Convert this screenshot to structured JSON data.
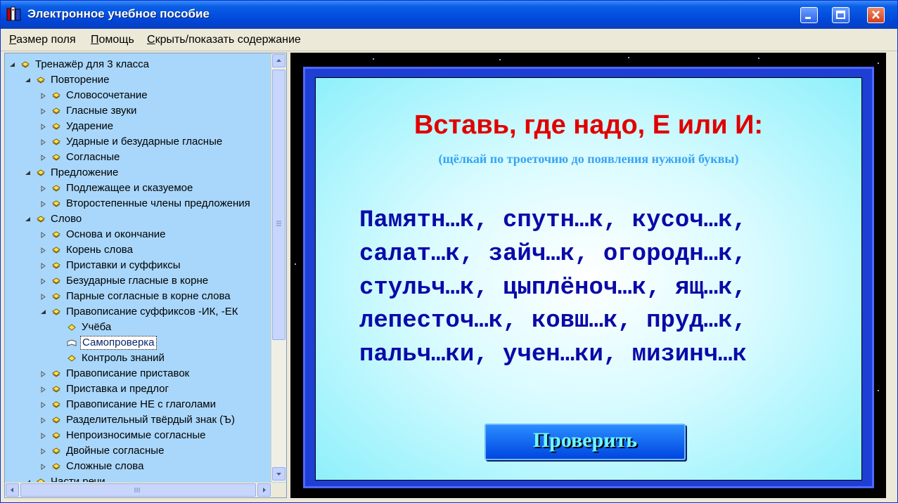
{
  "window": {
    "title": "Электронное учебное пособие"
  },
  "menu": [
    {
      "label": "Размер поля",
      "accel": "Р",
      "rest": "азмер поля"
    },
    {
      "label": "Помощь",
      "accel": "П",
      "rest": "омощь"
    },
    {
      "label": "Скрыть/показать содержание",
      "accel": "С",
      "rest": "крыть/показать содержание"
    }
  ],
  "tree": [
    {
      "label": "Тренажёр для 3 класса",
      "level": 0,
      "expander": "open",
      "icon": "book-icon"
    },
    {
      "label": "Повторение",
      "level": 1,
      "expander": "open",
      "icon": "book-icon"
    },
    {
      "label": "Словосочетание",
      "level": 2,
      "expander": "closed",
      "icon": "book-icon"
    },
    {
      "label": "Гласные звуки",
      "level": 2,
      "expander": "closed",
      "icon": "book-icon"
    },
    {
      "label": "Ударение",
      "level": 2,
      "expander": "closed",
      "icon": "book-icon"
    },
    {
      "label": "Ударные и безударные гласные",
      "level": 2,
      "expander": "closed",
      "icon": "book-icon"
    },
    {
      "label": "Согласные",
      "level": 2,
      "expander": "closed",
      "icon": "book-icon"
    },
    {
      "label": "Предложение",
      "level": 1,
      "expander": "open",
      "icon": "book-icon"
    },
    {
      "label": "Подлежащее и сказуемое",
      "level": 2,
      "expander": "closed",
      "icon": "book-icon"
    },
    {
      "label": "Второстепенные члены предложения",
      "level": 2,
      "expander": "closed",
      "icon": "book-icon"
    },
    {
      "label": "Слово",
      "level": 1,
      "expander": "open",
      "icon": "book-icon"
    },
    {
      "label": "Основа и окончание",
      "level": 2,
      "expander": "closed",
      "icon": "book-icon"
    },
    {
      "label": "Корень слова",
      "level": 2,
      "expander": "closed",
      "icon": "book-icon"
    },
    {
      "label": "Приставки и суффиксы",
      "level": 2,
      "expander": "closed",
      "icon": "book-icon"
    },
    {
      "label": "Безударные гласные в корне",
      "level": 2,
      "expander": "closed",
      "icon": "book-icon"
    },
    {
      "label": "Парные согласные в корне слова",
      "level": 2,
      "expander": "closed",
      "icon": "book-icon"
    },
    {
      "label": "Правописание суффиксов -ИК, -ЕК",
      "level": 2,
      "expander": "open",
      "icon": "book-icon"
    },
    {
      "label": "Учёба",
      "level": 3,
      "expander": "none",
      "icon": "page-icon"
    },
    {
      "label": "Самопроверка",
      "level": 3,
      "expander": "none",
      "icon": "open-page-icon",
      "selected": true
    },
    {
      "label": "Контроль знаний",
      "level": 3,
      "expander": "none",
      "icon": "page-icon"
    },
    {
      "label": "Правописание приставок",
      "level": 2,
      "expander": "closed",
      "icon": "book-icon"
    },
    {
      "label": "Приставка и предлог",
      "level": 2,
      "expander": "closed",
      "icon": "book-icon"
    },
    {
      "label": "Правописание НЕ с глаголами",
      "level": 2,
      "expander": "closed",
      "icon": "book-icon"
    },
    {
      "label": "Разделительный твёрдый знак (Ъ)",
      "level": 2,
      "expander": "closed",
      "icon": "book-icon"
    },
    {
      "label": "Непроизносимые согласные",
      "level": 2,
      "expander": "closed",
      "icon": "book-icon"
    },
    {
      "label": "Двойные согласные",
      "level": 2,
      "expander": "closed",
      "icon": "book-icon"
    },
    {
      "label": "Сложные слова",
      "level": 2,
      "expander": "closed",
      "icon": "book-icon"
    },
    {
      "label": "Части речи",
      "level": 1,
      "expander": "open",
      "icon": "book-icon"
    }
  ],
  "exercise": {
    "title": "Вставь, где надо, Е или И:",
    "subtitle": "(щёлкай по троеточию до появления нужной буквы)",
    "lines": [
      "Памятн…к, спутн…к, кусоч…к,",
      "салат…к, зайч…к, огородн…к,",
      "стульч…к, цыплёноч…к, ящ…к,",
      "лепесточ…к, ковш…к, пруд…к,",
      "пальч…ки, учен…ки, мизинч…к"
    ],
    "check_button": "Проверить"
  },
  "colors": {
    "titlebar": "#0046d8",
    "tree_bg": "#a9d7fb",
    "heading": "#e00000",
    "subtitle": "#36a4f4",
    "exercise_text": "#0a0aa8",
    "frame": "#1d3fd4",
    "button_text": "#6ff7ff"
  }
}
